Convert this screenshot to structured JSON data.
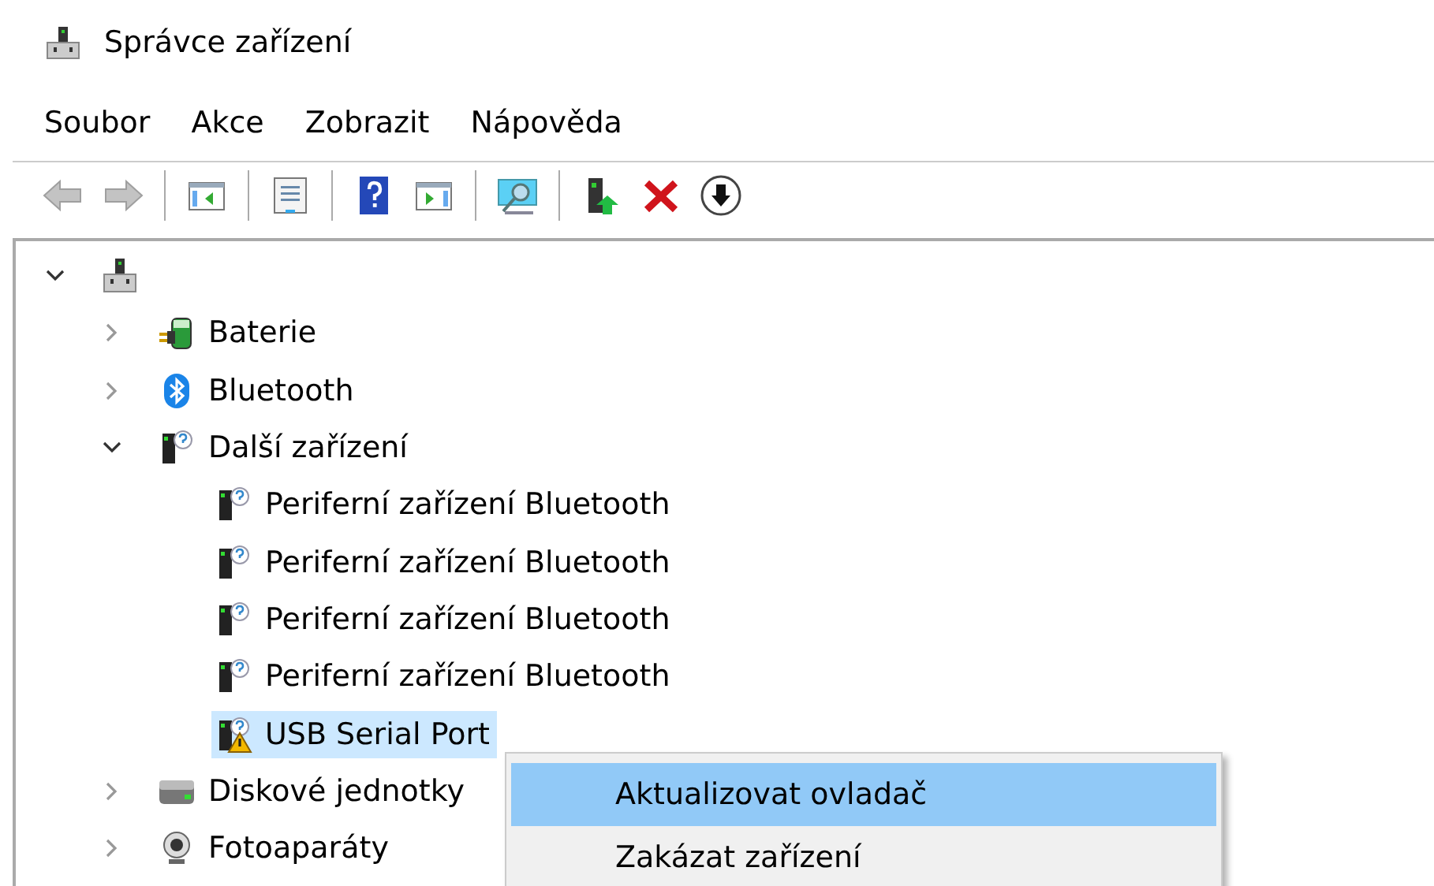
{
  "window": {
    "title": "Správce zařízení"
  },
  "menu": [
    "Soubor",
    "Akce",
    "Zobrazit",
    "Nápověda"
  ],
  "toolbar": [
    [
      {
        "kind": "back",
        "disabled": true
      },
      {
        "kind": "forward",
        "disabled": true
      }
    ],
    [
      {
        "kind": "console-tree",
        "disabled": false
      }
    ],
    [
      {
        "kind": "properties",
        "disabled": false
      }
    ],
    [
      {
        "kind": "help",
        "disabled": false
      },
      {
        "kind": "action-pane",
        "disabled": false
      }
    ],
    [
      {
        "kind": "scan",
        "disabled": false
      }
    ],
    [
      {
        "kind": "update-driver",
        "disabled": false
      },
      {
        "kind": "uninstall",
        "disabled": false
      },
      {
        "kind": "download",
        "disabled": false
      }
    ]
  ],
  "tree": {
    "root": {
      "kind": "computer",
      "expanded": true,
      "selected": false,
      "children": [
        {
          "kind": "battery",
          "label": "Baterie",
          "expanded": false,
          "selected": false
        },
        {
          "kind": "bluetooth",
          "label": "Bluetooth",
          "expanded": false,
          "selected": false
        },
        {
          "kind": "unknown",
          "label": "Další zařízení",
          "expanded": true,
          "selected": false,
          "children": [
            {
              "kind": "unknown",
              "label": "Periferní zařízení Bluetooth",
              "selected": false
            },
            {
              "kind": "unknown",
              "label": "Periferní zařízení Bluetooth",
              "selected": false
            },
            {
              "kind": "unknown",
              "label": "Periferní zařízení Bluetooth",
              "selected": false
            },
            {
              "kind": "unknown",
              "label": "Periferní zařízení Bluetooth",
              "selected": false
            },
            {
              "kind": "warning",
              "label": "USB Serial Port",
              "selected": true
            }
          ]
        },
        {
          "kind": "disk",
          "label": "Diskové jednotky",
          "expanded": false,
          "selected": false
        },
        {
          "kind": "camera",
          "label": "Fotoaparáty",
          "expanded": false,
          "selected": false
        }
      ]
    }
  },
  "context_menu": [
    {
      "label": "Aktualizovat ovladač",
      "selected": true
    },
    {
      "label": "Zakázat zařízení",
      "selected": false
    }
  ]
}
